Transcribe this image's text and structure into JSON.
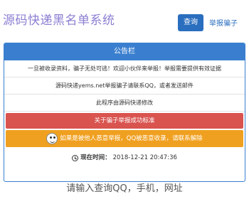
{
  "header": {
    "title": "源码快递黑名单系统",
    "query_button": "查询",
    "report_link": "举报骗子"
  },
  "notice": {
    "heading": "公告栏",
    "lines": [
      "一旦被收录资料，骗子无处可逃！欢迎小伙伴来举报！举报需要提供有效证据",
      "源码快递yems.net举报骗子请联系QQ，或者发送邮件",
      "此程序由源码快递修改"
    ],
    "red_bar": "关于骗子举报成功标准",
    "orange_bar": "如果是被他人恶意举报，QQ被恶意收录，请联系解除",
    "time_label": "现在时间：",
    "time_value": "2018-12-21 20:47:36"
  },
  "footer": {
    "prompt": "请输入查询QQ，手机，网址"
  },
  "colors": {
    "brand": "#8a7fd2",
    "primary": "#3a7fcf",
    "danger": "#d9534f",
    "warning": "#f0a020"
  }
}
